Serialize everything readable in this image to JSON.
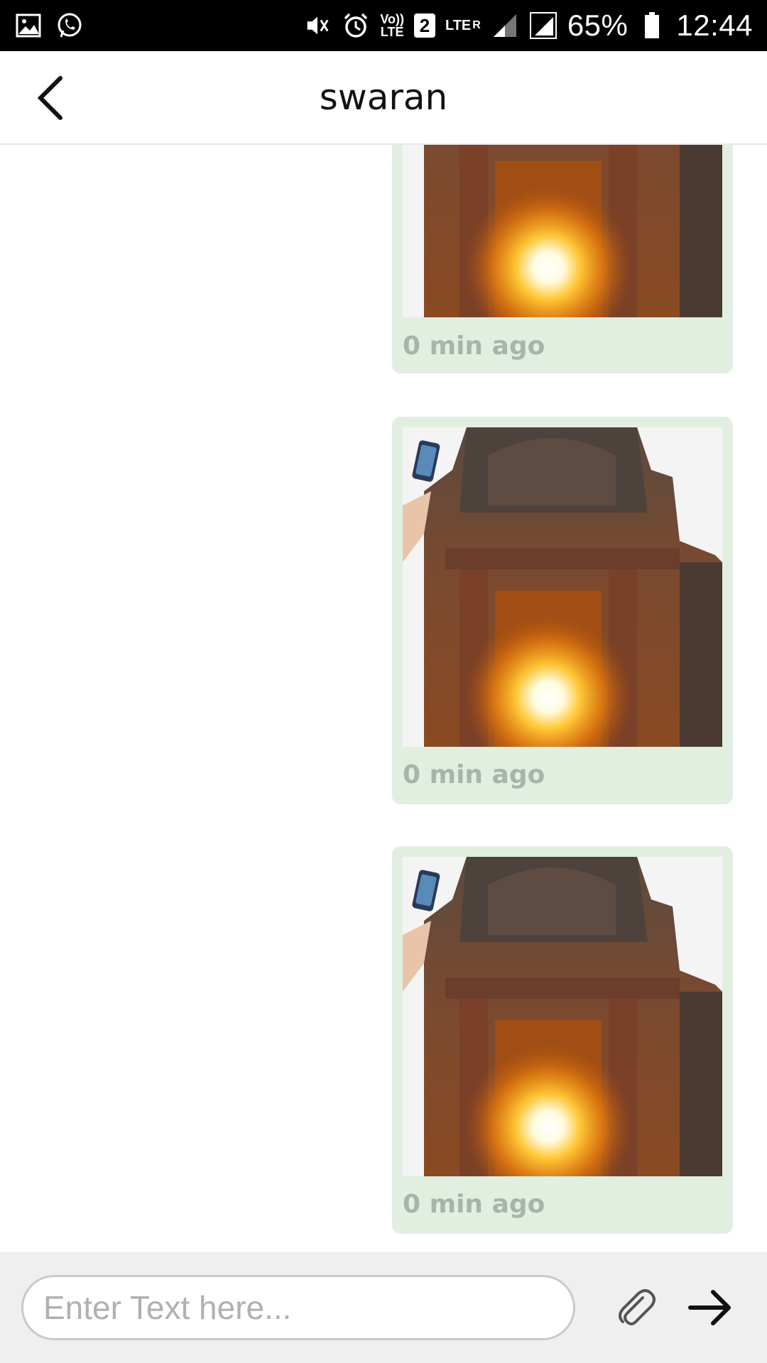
{
  "status_bar": {
    "battery": "65%",
    "time": "12:44",
    "sim_badge": "2",
    "volte_top": "Vo))",
    "volte_bottom": "LTE",
    "lte_label": "LTE",
    "roaming_label": "R",
    "icons": [
      "gallery-icon",
      "whatsapp-icon",
      "mute-vibrate-icon",
      "alarm-icon",
      "volte-icon",
      "sim2-icon",
      "lte-icon",
      "signal-icon",
      "battery-icon"
    ]
  },
  "header": {
    "title": "swaran",
    "back_icon": "chevron-left-icon"
  },
  "messages": [
    {
      "type": "image",
      "timestamp": "0 min ago",
      "image_description_icon": "temple-sun-photo"
    },
    {
      "type": "image",
      "timestamp": "0 min ago",
      "image_description_icon": "temple-sun-photo"
    },
    {
      "type": "image",
      "timestamp": "0 min ago",
      "image_description_icon": "temple-sun-photo"
    }
  ],
  "composer": {
    "placeholder": "Enter Text here...",
    "value": "",
    "attach_icon": "paperclip-icon",
    "send_icon": "arrow-right-icon"
  },
  "colors": {
    "bubble_bg": "#e1efe1",
    "timestamp": "#a9b3ab",
    "status_bar_bg": "#000000",
    "input_bar_bg": "#efefef"
  }
}
